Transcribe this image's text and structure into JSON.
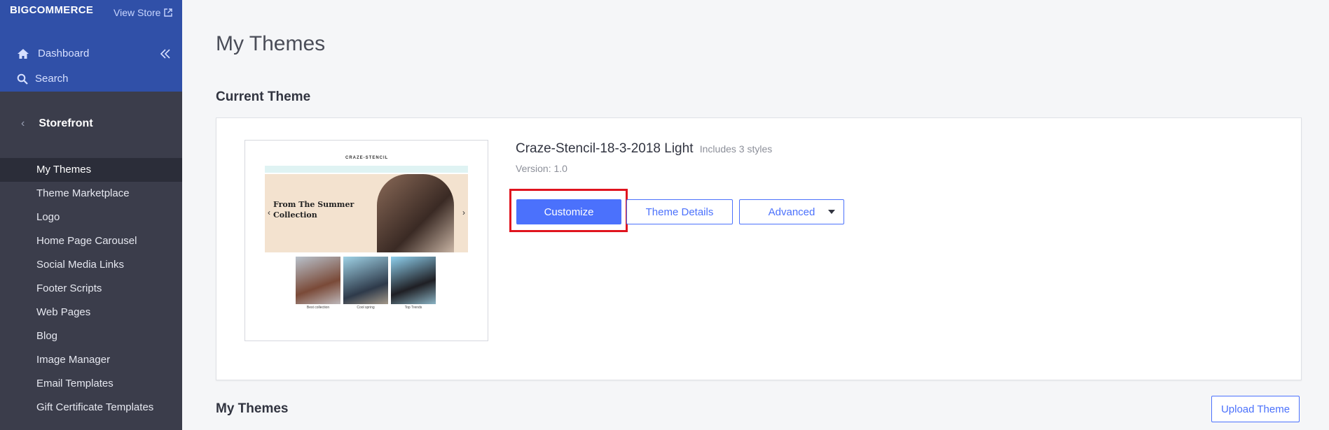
{
  "sidebar": {
    "logo": "BIGCOMMERCE",
    "view_store": "View Store",
    "dashboard": "Dashboard",
    "search": "Search",
    "section": "Storefront",
    "items": [
      {
        "label": "My Themes",
        "active": true
      },
      {
        "label": "Theme Marketplace"
      },
      {
        "label": "Logo"
      },
      {
        "label": "Home Page Carousel"
      },
      {
        "label": "Social Media Links"
      },
      {
        "label": "Footer Scripts"
      },
      {
        "label": "Web Pages"
      },
      {
        "label": "Blog"
      },
      {
        "label": "Image Manager"
      },
      {
        "label": "Email Templates"
      },
      {
        "label": "Gift Certificate Templates"
      }
    ]
  },
  "main": {
    "title": "My Themes",
    "current_theme_heading": "Current Theme",
    "theme": {
      "name": "Craze-Stencil-18-3-2018 Light",
      "styles": "Includes 3 styles",
      "version": "Version: 1.0",
      "preview": {
        "brand": "CRAZE-STENCIL",
        "hero_line1": "From The Summer",
        "hero_line2": "Collection",
        "products": [
          "Best collection",
          "Cool spring",
          "Top Trends"
        ]
      }
    },
    "buttons": {
      "customize": "Customize",
      "theme_details": "Theme Details",
      "advanced": "Advanced"
    },
    "my_themes_heading": "My Themes",
    "upload_theme": "Upload Theme"
  },
  "colors": {
    "sidebar_top": "#3050a8",
    "sidebar_bg": "#3b3d4b",
    "primary": "#4b71fc",
    "highlight": "#e0141e"
  }
}
